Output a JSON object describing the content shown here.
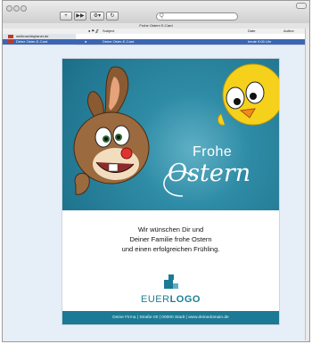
{
  "window": {
    "title": "Frohe Ostern E-Card"
  },
  "toolbar": {
    "buttons": [
      {
        "label": "+",
        "icon": "new-message-icon"
      },
      {
        "label": "▶▶",
        "icon": "forward-icon"
      },
      {
        "label": "⚙▾",
        "icon": "action-gear-icon"
      },
      {
        "label": "↻",
        "icon": "refresh-icon"
      }
    ],
    "search_placeholder": ""
  },
  "columns": {
    "subject": "Subject",
    "date": "Date",
    "author": "Author"
  },
  "sidebar": {
    "items": [
      {
        "label": "weihnachtsplaner.de"
      },
      {
        "label": "Deine Oster-E-Card"
      }
    ]
  },
  "message": {
    "subject": "Deine Oster-E-Card",
    "date": "heute 9:00 Uhr"
  },
  "card": {
    "headline_frohe": "Frohe",
    "headline_ostern": "Ostern",
    "greeting": [
      "Wir wünschen Dir und",
      "Deiner Familie frohe Ostern",
      "und einen erfolgreichen Frühling."
    ],
    "logo_part1": "EUER",
    "logo_part2": "LOGO",
    "footer": "Deine Firma | Straße 00 | 00000 Stadt | www.deinedomain.de"
  },
  "colors": {
    "teal": "#1c7a95",
    "selection": "#3c66b4",
    "preview_bg": "#e6eef8"
  }
}
